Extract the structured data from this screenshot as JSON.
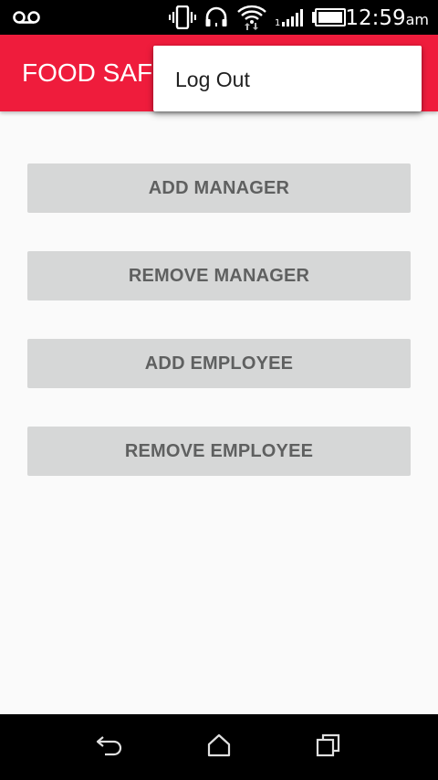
{
  "status_bar": {
    "time": "12:59",
    "ampm": "am",
    "icons": [
      "voicemail-icon",
      "vibrate-icon",
      "headset-icon",
      "wifi-icon",
      "signal-icon",
      "battery-icon"
    ]
  },
  "app_bar": {
    "title": "FOOD SAFETY",
    "background_color": "#ef1c3c"
  },
  "overflow_menu": {
    "items": [
      {
        "label": "Log Out"
      }
    ]
  },
  "actions": {
    "buttons": [
      {
        "label": "ADD MANAGER"
      },
      {
        "label": "REMOVE MANAGER"
      },
      {
        "label": "ADD EMPLOYEE"
      },
      {
        "label": "REMOVE EMPLOYEE"
      }
    ]
  },
  "nav_bar": {
    "icons": [
      "back-icon",
      "home-icon",
      "recents-icon"
    ]
  }
}
